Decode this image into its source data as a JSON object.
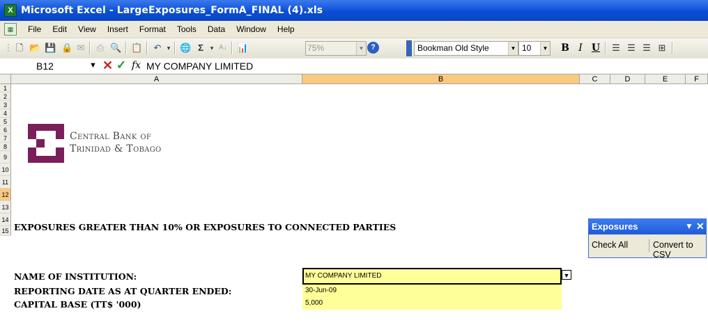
{
  "window": {
    "title": "Microsoft Excel - LargeExposures_FormA_FINAL (4).xls",
    "app_icon": "excel-icon"
  },
  "menu": [
    {
      "label": "File"
    },
    {
      "label": "Edit"
    },
    {
      "label": "View"
    },
    {
      "label": "Insert"
    },
    {
      "label": "Format"
    },
    {
      "label": "Tools"
    },
    {
      "label": "Data"
    },
    {
      "label": "Window"
    },
    {
      "label": "Help"
    }
  ],
  "toolbar": {
    "zoom": "75%",
    "font": "Bookman Old Style",
    "size": "10",
    "bold": "B",
    "italic": "I",
    "underline": "U",
    "sigma": "Σ"
  },
  "formula_bar": {
    "name_box": "B12",
    "fx": "fx",
    "content": "MY COMPANY LIMITED"
  },
  "columns": [
    "A",
    "B",
    "C",
    "D",
    "E",
    "F"
  ],
  "rows": [
    "1",
    "2",
    "3",
    "4",
    "5",
    "6",
    "7",
    "8",
    "9",
    "10",
    "11",
    "12",
    "13",
    "14",
    "15"
  ],
  "logo": {
    "line1": "Central Bank of",
    "line2": "Trinidad & Tobago"
  },
  "sheet": {
    "heading": "EXPOSURES GREATER THAN 10% OR EXPOSURES TO CONNECTED PARTIES",
    "name_label": "NAME OF INSTITUTION:",
    "name_value": "MY COMPANY LIMITED",
    "date_label": "REPORTING DATE AS AT QUARTER ENDED:",
    "date_value": "30-Jun-09",
    "capital_label": "CAPITAL BASE (TT$ '000)",
    "capital_value": "5,000"
  },
  "float_toolbar": {
    "title": "Exposures",
    "check_all": "Check All",
    "convert": "Convert to CSV"
  },
  "colors": {
    "title_bar": "#0a4fd6",
    "selected_header": "#f8c97f",
    "input_fill": "#ffff99",
    "logo": "#7b1f5a"
  }
}
